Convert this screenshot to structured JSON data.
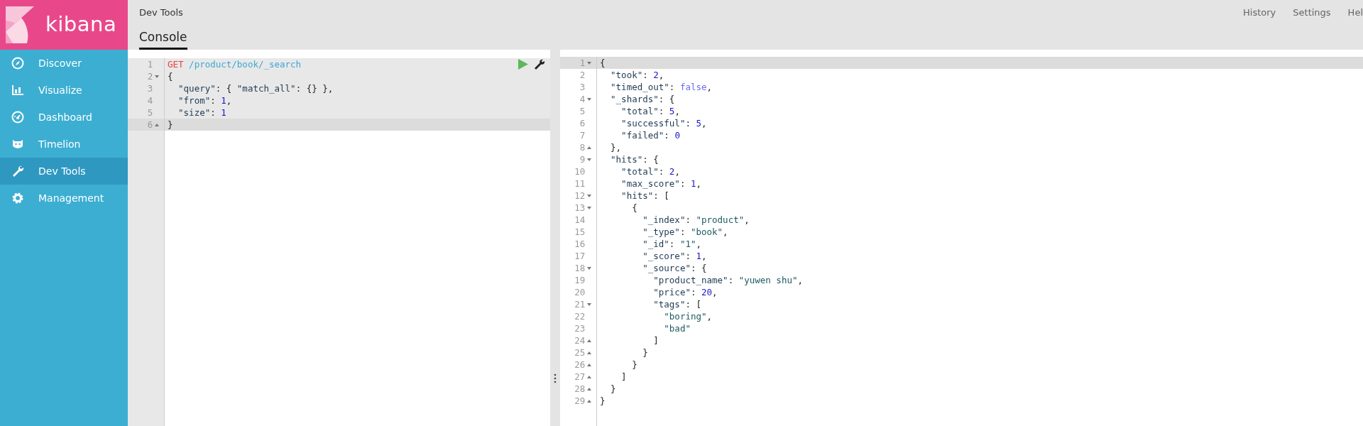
{
  "logo": {
    "text": "kibana"
  },
  "sidebar": {
    "items": [
      {
        "label": "Discover",
        "selected": false
      },
      {
        "label": "Visualize",
        "selected": false
      },
      {
        "label": "Dashboard",
        "selected": false
      },
      {
        "label": "Timelion",
        "selected": false
      },
      {
        "label": "Dev Tools",
        "selected": true
      },
      {
        "label": "Management",
        "selected": false
      }
    ]
  },
  "header": {
    "breadcrumb": "Dev Tools",
    "links": [
      "History",
      "Settings",
      "Hel"
    ],
    "tabs": [
      {
        "label": "Console",
        "selected": true
      }
    ]
  },
  "request": {
    "lines": [
      {
        "number": "1",
        "kind": "plain",
        "active": false,
        "tokens": [
          {
            "kind": "method",
            "text": "GET"
          },
          {
            "kind": "url",
            "text": " /product/book/_search"
          }
        ]
      },
      {
        "number": "2",
        "kind": "fold_start",
        "active": false,
        "tokens": [
          {
            "kind": "punct",
            "text": "{"
          }
        ]
      },
      {
        "number": "3",
        "kind": "plain",
        "active": false,
        "tokens": [
          {
            "kind": "key",
            "text": "  \"query\""
          },
          {
            "kind": "punct",
            "text": ": { "
          },
          {
            "kind": "key",
            "text": "\"match_all\""
          },
          {
            "kind": "punct",
            "text": ": {} },"
          }
        ]
      },
      {
        "number": "4",
        "kind": "plain",
        "active": false,
        "tokens": [
          {
            "kind": "key",
            "text": "  \"from\""
          },
          {
            "kind": "punct",
            "text": ": "
          },
          {
            "kind": "number",
            "text": "1"
          },
          {
            "kind": "punct",
            "text": ","
          }
        ]
      },
      {
        "number": "5",
        "kind": "plain",
        "active": false,
        "tokens": [
          {
            "kind": "key",
            "text": "  \"size\""
          },
          {
            "kind": "punct",
            "text": ": "
          },
          {
            "kind": "number",
            "text": "1"
          }
        ]
      },
      {
        "number": "6",
        "kind": "fold_end",
        "active": true,
        "tokens": [
          {
            "kind": "punct",
            "text": "}"
          }
        ]
      }
    ]
  },
  "response": {
    "lines": [
      {
        "number": "1",
        "kind": "fold_start",
        "active": true,
        "tokens": [
          {
            "kind": "punct",
            "text": "{"
          }
        ]
      },
      {
        "number": "2",
        "kind": "plain",
        "active": false,
        "tokens": [
          {
            "kind": "key",
            "text": "  \"took\""
          },
          {
            "kind": "punct",
            "text": ": "
          },
          {
            "kind": "number",
            "text": "2"
          },
          {
            "kind": "punct",
            "text": ","
          }
        ]
      },
      {
        "number": "3",
        "kind": "plain",
        "active": false,
        "tokens": [
          {
            "kind": "key",
            "text": "  \"timed_out\""
          },
          {
            "kind": "punct",
            "text": ": "
          },
          {
            "kind": "boolean",
            "text": "false"
          },
          {
            "kind": "punct",
            "text": ","
          }
        ]
      },
      {
        "number": "4",
        "kind": "fold_start",
        "active": false,
        "tokens": [
          {
            "kind": "key",
            "text": "  \"_shards\""
          },
          {
            "kind": "punct",
            "text": ": {"
          }
        ]
      },
      {
        "number": "5",
        "kind": "plain",
        "active": false,
        "tokens": [
          {
            "kind": "key",
            "text": "    \"total\""
          },
          {
            "kind": "punct",
            "text": ": "
          },
          {
            "kind": "number",
            "text": "5"
          },
          {
            "kind": "punct",
            "text": ","
          }
        ]
      },
      {
        "number": "6",
        "kind": "plain",
        "active": false,
        "tokens": [
          {
            "kind": "key",
            "text": "    \"successful\""
          },
          {
            "kind": "punct",
            "text": ": "
          },
          {
            "kind": "number",
            "text": "5"
          },
          {
            "kind": "punct",
            "text": ","
          }
        ]
      },
      {
        "number": "7",
        "kind": "plain",
        "active": false,
        "tokens": [
          {
            "kind": "key",
            "text": "    \"failed\""
          },
          {
            "kind": "punct",
            "text": ": "
          },
          {
            "kind": "number",
            "text": "0"
          }
        ]
      },
      {
        "number": "8",
        "kind": "fold_end",
        "active": false,
        "tokens": [
          {
            "kind": "punct",
            "text": "  },"
          }
        ]
      },
      {
        "number": "9",
        "kind": "fold_start",
        "active": false,
        "tokens": [
          {
            "kind": "key",
            "text": "  \"hits\""
          },
          {
            "kind": "punct",
            "text": ": {"
          }
        ]
      },
      {
        "number": "10",
        "kind": "plain",
        "active": false,
        "tokens": [
          {
            "kind": "key",
            "text": "    \"total\""
          },
          {
            "kind": "punct",
            "text": ": "
          },
          {
            "kind": "number",
            "text": "2"
          },
          {
            "kind": "punct",
            "text": ","
          }
        ]
      },
      {
        "number": "11",
        "kind": "plain",
        "active": false,
        "tokens": [
          {
            "kind": "key",
            "text": "    \"max_score\""
          },
          {
            "kind": "punct",
            "text": ": "
          },
          {
            "kind": "number",
            "text": "1"
          },
          {
            "kind": "punct",
            "text": ","
          }
        ]
      },
      {
        "number": "12",
        "kind": "fold_start",
        "active": false,
        "tokens": [
          {
            "kind": "key",
            "text": "    \"hits\""
          },
          {
            "kind": "punct",
            "text": ": ["
          }
        ]
      },
      {
        "number": "13",
        "kind": "fold_start",
        "active": false,
        "tokens": [
          {
            "kind": "punct",
            "text": "      {"
          }
        ]
      },
      {
        "number": "14",
        "kind": "plain",
        "active": false,
        "tokens": [
          {
            "kind": "key",
            "text": "        \"_index\""
          },
          {
            "kind": "punct",
            "text": ": "
          },
          {
            "kind": "string",
            "text": "\"product\""
          },
          {
            "kind": "punct",
            "text": ","
          }
        ]
      },
      {
        "number": "15",
        "kind": "plain",
        "active": false,
        "tokens": [
          {
            "kind": "key",
            "text": "        \"_type\""
          },
          {
            "kind": "punct",
            "text": ": "
          },
          {
            "kind": "string",
            "text": "\"book\""
          },
          {
            "kind": "punct",
            "text": ","
          }
        ]
      },
      {
        "number": "16",
        "kind": "plain",
        "active": false,
        "tokens": [
          {
            "kind": "key",
            "text": "        \"_id\""
          },
          {
            "kind": "punct",
            "text": ": "
          },
          {
            "kind": "string",
            "text": "\"1\""
          },
          {
            "kind": "punct",
            "text": ","
          }
        ]
      },
      {
        "number": "17",
        "kind": "plain",
        "active": false,
        "tokens": [
          {
            "kind": "key",
            "text": "        \"_score\""
          },
          {
            "kind": "punct",
            "text": ": "
          },
          {
            "kind": "number",
            "text": "1"
          },
          {
            "kind": "punct",
            "text": ","
          }
        ]
      },
      {
        "number": "18",
        "kind": "fold_start",
        "active": false,
        "tokens": [
          {
            "kind": "key",
            "text": "        \"_source\""
          },
          {
            "kind": "punct",
            "text": ": {"
          }
        ]
      },
      {
        "number": "19",
        "kind": "plain",
        "active": false,
        "tokens": [
          {
            "kind": "key",
            "text": "          \"product_name\""
          },
          {
            "kind": "punct",
            "text": ": "
          },
          {
            "kind": "string",
            "text": "\"yuwen shu\""
          },
          {
            "kind": "punct",
            "text": ","
          }
        ]
      },
      {
        "number": "20",
        "kind": "plain",
        "active": false,
        "tokens": [
          {
            "kind": "key",
            "text": "          \"price\""
          },
          {
            "kind": "punct",
            "text": ": "
          },
          {
            "kind": "number",
            "text": "20"
          },
          {
            "kind": "punct",
            "text": ","
          }
        ]
      },
      {
        "number": "21",
        "kind": "fold_start",
        "active": false,
        "tokens": [
          {
            "kind": "key",
            "text": "          \"tags\""
          },
          {
            "kind": "punct",
            "text": ": ["
          }
        ]
      },
      {
        "number": "22",
        "kind": "plain",
        "active": false,
        "tokens": [
          {
            "kind": "string",
            "text": "            \"boring\""
          },
          {
            "kind": "punct",
            "text": ","
          }
        ]
      },
      {
        "number": "23",
        "kind": "plain",
        "active": false,
        "tokens": [
          {
            "kind": "string",
            "text": "            \"bad\""
          }
        ]
      },
      {
        "number": "24",
        "kind": "fold_end",
        "active": false,
        "tokens": [
          {
            "kind": "punct",
            "text": "          ]"
          }
        ]
      },
      {
        "number": "25",
        "kind": "fold_end",
        "active": false,
        "tokens": [
          {
            "kind": "punct",
            "text": "        }"
          }
        ]
      },
      {
        "number": "26",
        "kind": "fold_end",
        "active": false,
        "tokens": [
          {
            "kind": "punct",
            "text": "      }"
          }
        ]
      },
      {
        "number": "27",
        "kind": "fold_end",
        "active": false,
        "tokens": [
          {
            "kind": "punct",
            "text": "    ]"
          }
        ]
      },
      {
        "number": "28",
        "kind": "fold_end",
        "active": false,
        "tokens": [
          {
            "kind": "punct",
            "text": "  }"
          }
        ]
      },
      {
        "number": "29",
        "kind": "fold_end",
        "active": false,
        "tokens": [
          {
            "kind": "punct",
            "text": "}"
          }
        ]
      }
    ]
  }
}
